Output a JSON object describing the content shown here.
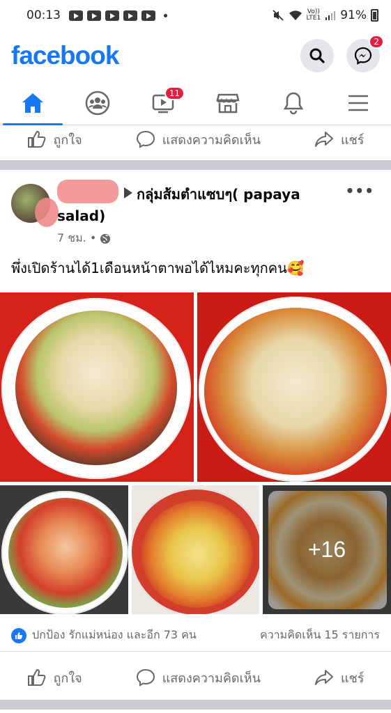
{
  "status_bar": {
    "time": "00:13",
    "volte": "Vo))",
    "lte": "LTE1",
    "battery": "91%"
  },
  "header": {
    "logo": "facebook",
    "messenger_badge": "2"
  },
  "nav": {
    "tabs": [
      {
        "name": "home",
        "active": true
      },
      {
        "name": "groups"
      },
      {
        "name": "watch",
        "badge": "11"
      },
      {
        "name": "marketplace"
      },
      {
        "name": "notifications"
      },
      {
        "name": "menu"
      }
    ]
  },
  "actions": {
    "like": "ถูกใจ",
    "comment": "แสดงความคิดเห็น",
    "share": "แชร์"
  },
  "post": {
    "group_name": "กลุ่มส้มตำแซบๆ( papaya salad)",
    "time": "7 ชม. •",
    "text": "พึ่งเปิดร้านได้1เดือนหน้าตาพอได้ไหมคะทุกคน🥰",
    "more_photos": "+16",
    "reactions_text": "ปกป้อง รักแม่หน่อง และอีก 73 คน",
    "comments_count": "ความคิดเห็น 15 รายการ"
  },
  "colors": {
    "brand": "#1877f2",
    "badge": "#e41e3f",
    "secondary_text": "#65676b"
  }
}
